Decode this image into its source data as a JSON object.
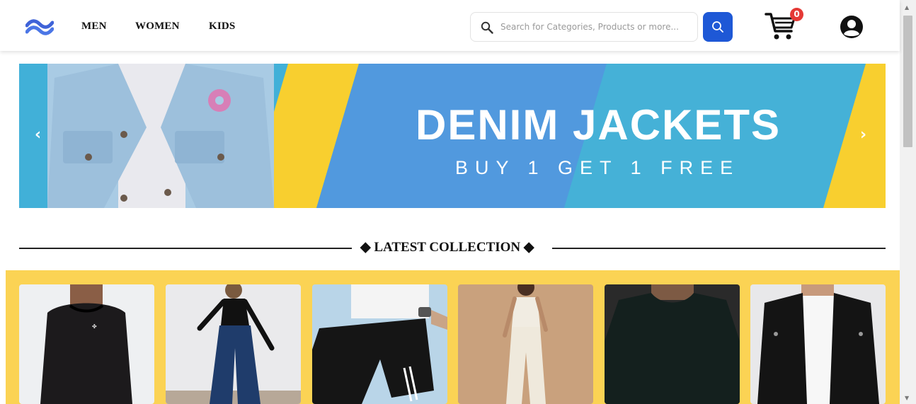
{
  "header": {
    "logo_icon": "wave-logo-icon",
    "nav": [
      {
        "label": "MEN"
      },
      {
        "label": "WOMEN"
      },
      {
        "label": "KIDS"
      }
    ],
    "search": {
      "placeholder": "Search for Categories, Products or more...",
      "icon": "search-icon",
      "button_icon": "search-icon"
    },
    "cart": {
      "icon": "cart-icon",
      "count": "0"
    },
    "account": {
      "icon": "user-circle-icon"
    }
  },
  "banner": {
    "title": "DENIM JACKETS",
    "subtitle": "BUY 1 GET 1 FREE",
    "prev_label": "‹",
    "next_label": "›"
  },
  "section": {
    "title": "◆ LATEST COLLECTION ◆"
  },
  "products": [
    {
      "icon": "black-sweatshirt-photo"
    },
    {
      "icon": "black-top-jeans-photo"
    },
    {
      "icon": "black-shorts-photo"
    },
    {
      "icon": "white-jumpsuit-photo"
    },
    {
      "icon": "black-tshirt-photo"
    },
    {
      "icon": "black-jacket-photo"
    }
  ],
  "colors": {
    "accent_blue": "#1e58d6",
    "banner_yellow": "#f8cf2f",
    "banner_blue": "#5199de",
    "collection_bg": "#fbd354",
    "badge_red": "#e53935"
  }
}
